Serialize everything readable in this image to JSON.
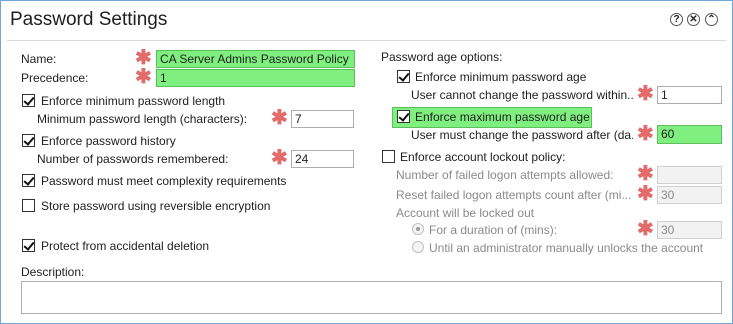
{
  "window": {
    "title": "Password Settings",
    "help_glyph": "?",
    "close_glyph": "✕",
    "collapse_glyph": "⌃"
  },
  "left": {
    "name_label": "Name:",
    "name_value": "CA Server Admins Password Policy",
    "precedence_label": "Precedence:",
    "precedence_value": "1",
    "enforce_min_length_label": "Enforce minimum password length",
    "min_length_label": "Minimum password length (characters):",
    "min_length_value": "7",
    "enforce_history_label": "Enforce password history",
    "remembered_label": "Number of passwords remembered:",
    "remembered_value": "24",
    "complexity_label": "Password must meet complexity requirements",
    "reversible_label": "Store password using reversible encryption",
    "protect_label": "Protect from accidental deletion",
    "description_label": "Description:",
    "description_value": ""
  },
  "right": {
    "age_options_label": "Password age options:",
    "enforce_min_age_label": "Enforce minimum password age",
    "min_age_label": "User cannot change the password within...",
    "min_age_value": "1",
    "enforce_max_age_label": "Enforce maximum password age",
    "max_age_label": "User must change the password after (da...",
    "max_age_value": "60",
    "lockout_label": "Enforce account lockout policy:",
    "failed_attempts_label": "Number of failed logon attempts allowed:",
    "failed_attempts_value": "",
    "reset_count_label": "Reset failed logon attempts count after (mi...",
    "reset_count_value": "30",
    "locked_out_label": "Account will be locked out",
    "duration_label": "For a duration of (mins):",
    "duration_value": "30",
    "until_admin_label": "Until an administrator manually unlocks the account"
  },
  "required_marker": "✱"
}
